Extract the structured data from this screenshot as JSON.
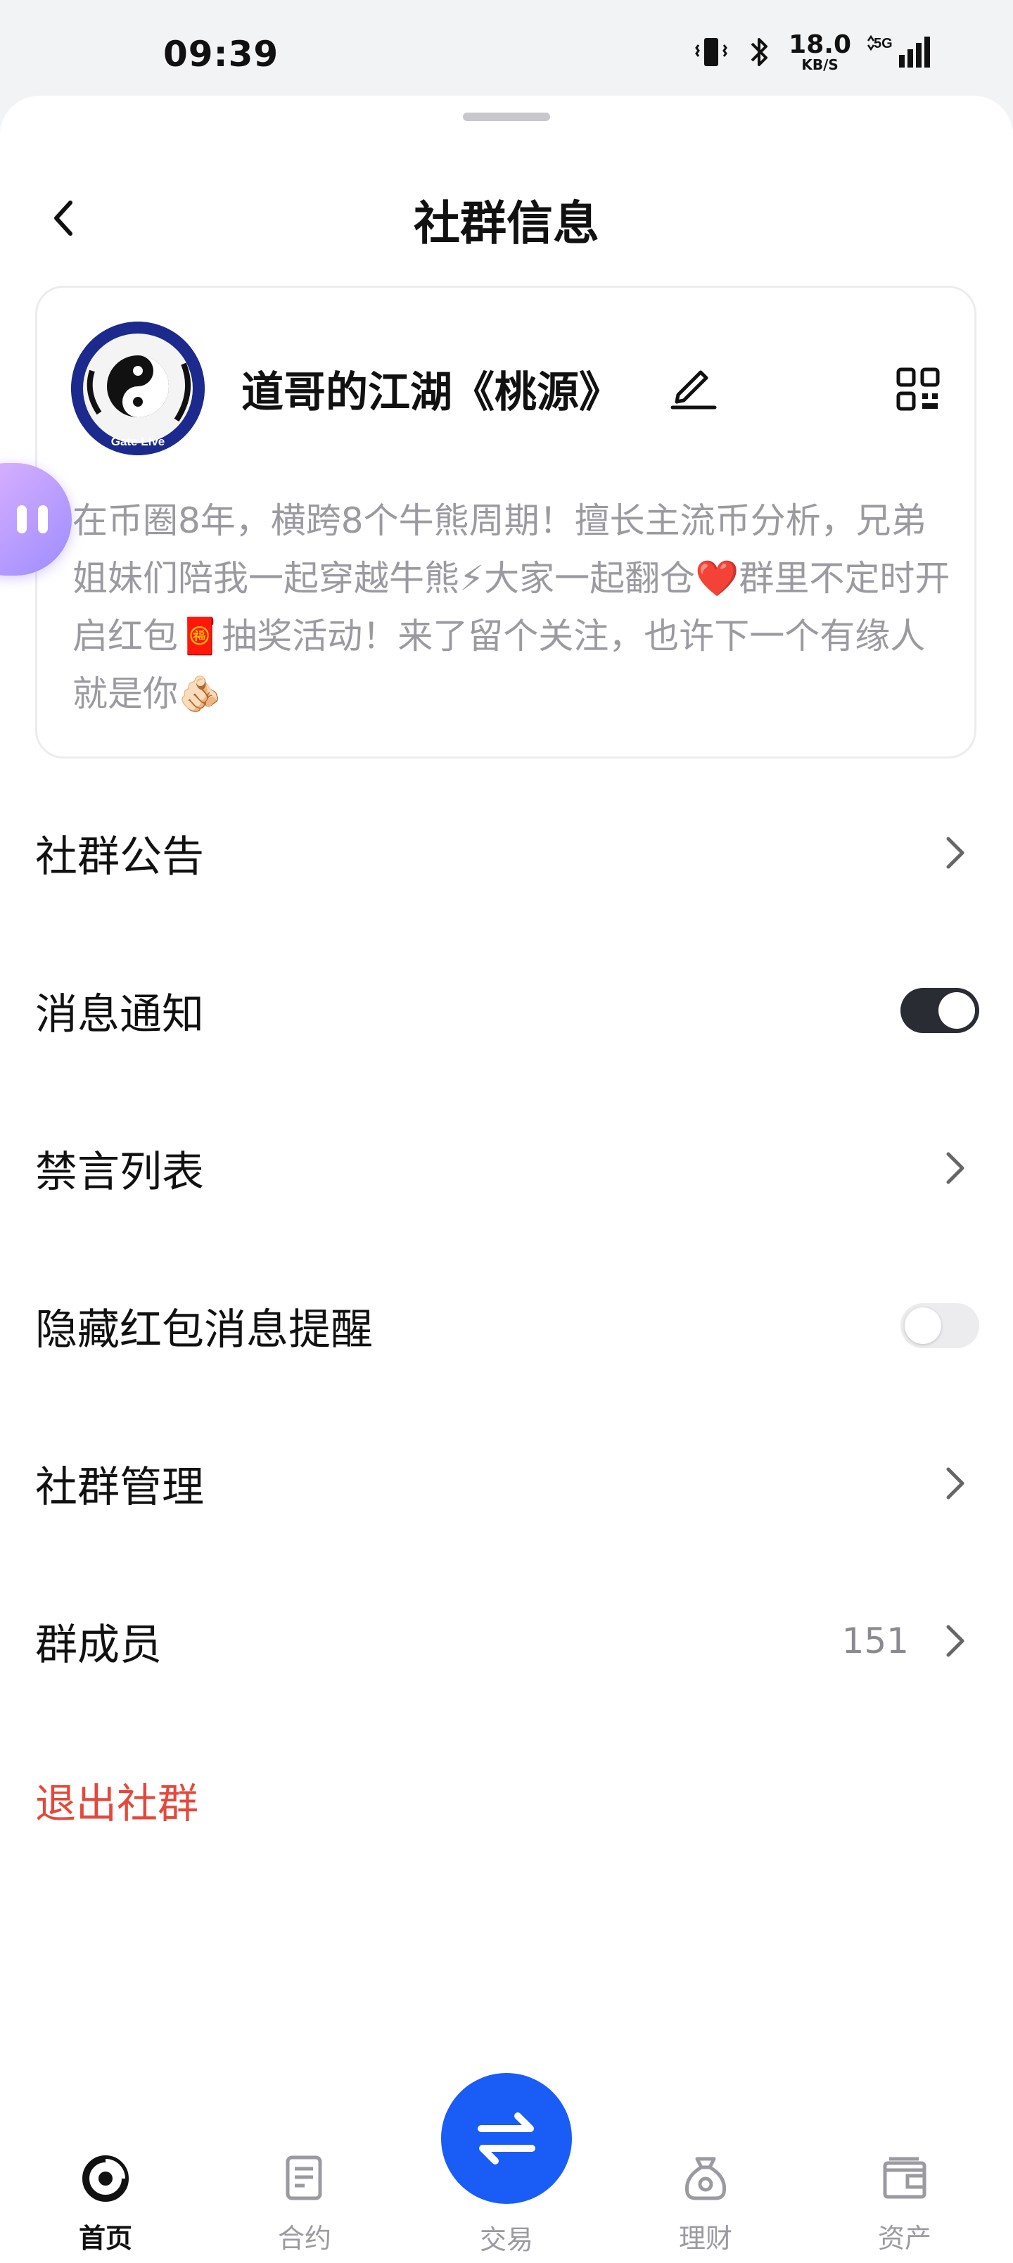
{
  "status_bar": {
    "time": "09:39",
    "speed_value": "18.0",
    "speed_unit": "KB/S",
    "network": "5G"
  },
  "header": {
    "title": "社群信息"
  },
  "group": {
    "name": "道哥的江湖《桃源》",
    "avatar_text": "Gate Live",
    "description": "在币圈8年，横跨8个牛熊周期！擅长主流币分析，兄弟姐妹们陪我一起穿越牛熊⚡大家一起翻仓❤️群里不定时开启红包🧧抽奖活动！来了留个关注，也许下一个有缘人就是你🫵🏻"
  },
  "settings": {
    "announcement": "社群公告",
    "notifications": {
      "label": "消息通知",
      "enabled": true
    },
    "mute_list": "禁言列表",
    "hide_red_packet": {
      "label": "隐藏红包消息提醒",
      "enabled": false
    },
    "management": "社群管理",
    "members": {
      "label": "群成员",
      "count": "151"
    },
    "exit": "退出社群"
  },
  "nav": {
    "items": [
      {
        "label": "首页",
        "icon": "home-icon",
        "active": true
      },
      {
        "label": "合约",
        "icon": "contract-icon",
        "active": false
      },
      {
        "label": "交易",
        "icon": "trade-icon",
        "active": false
      },
      {
        "label": "理财",
        "icon": "finance-icon",
        "active": false
      },
      {
        "label": "资产",
        "icon": "wallet-icon",
        "active": false
      }
    ]
  },
  "colors": {
    "accent": "#1a5cf6",
    "danger": "#e5483b",
    "toggle_on": "#2a2c33"
  }
}
